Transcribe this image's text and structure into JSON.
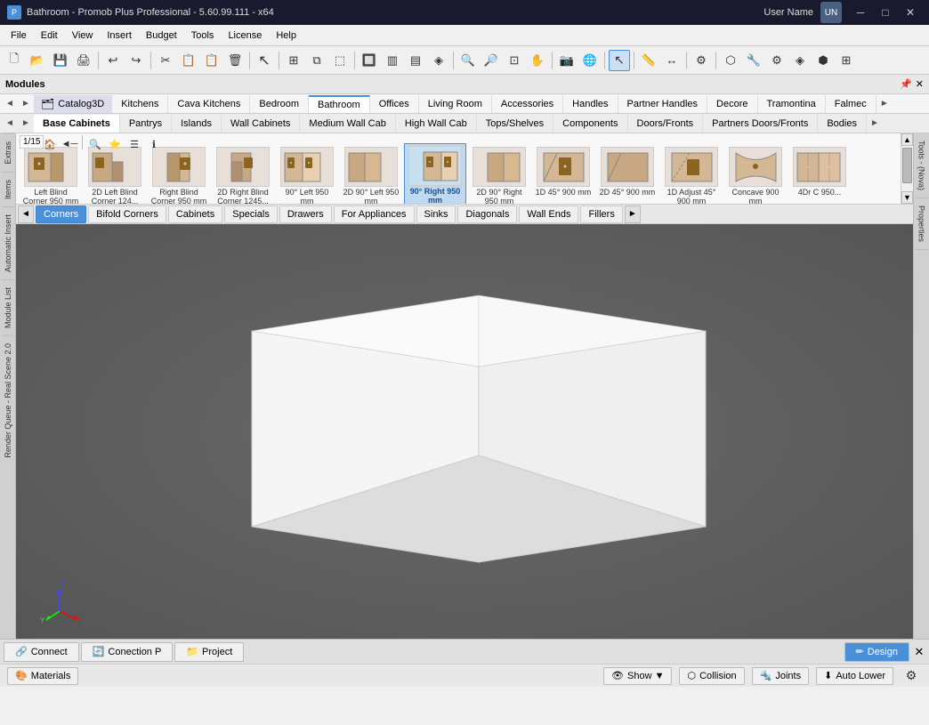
{
  "titlebar": {
    "icon": "P",
    "title": "Bathroom - Promob Plus Professional - 5.60.99.111 - x64",
    "user": "User Name",
    "user_abbr": "UN",
    "min": "─",
    "max": "□",
    "close": "✕"
  },
  "menubar": {
    "items": [
      "File",
      "Edit",
      "View",
      "Insert",
      "Budget",
      "Tools",
      "License",
      "Help"
    ]
  },
  "modules": {
    "title": "Modules",
    "pin_icon": "📌",
    "close_icon": "✕"
  },
  "catalog_tabs1": {
    "nav_left": "◄",
    "nav_right": "►",
    "catalog_label": "Catalog3D",
    "tabs": [
      "Kitchens",
      "Cava Kitchens",
      "Bedroom",
      "Bathroom",
      "Offices",
      "Living Room",
      "Accessories",
      "Handles",
      "Partner Handles",
      "Decore",
      "Tramontina",
      "Falmec",
      "►"
    ]
  },
  "catalog_tabs2": {
    "nav_left": "◄",
    "nav_right": "►",
    "tabs": [
      "Base Cabinets",
      "Pantrys",
      "Islands",
      "Wall Cabinets",
      "Medium Wall Cab",
      "High Wall Cab",
      "Tops/Shelves",
      "Components",
      "Doors/Fronts",
      "Partners Doors/Fronts",
      "Bodies",
      "►"
    ]
  },
  "catalog_items": {
    "page": "1/15",
    "items": [
      {
        "label": "Left Blind Corner 950 mm",
        "shape": "corner_left"
      },
      {
        "label": "2D Left Blind Corner 124...",
        "shape": "corner_2d_left"
      },
      {
        "label": "Right Blind Corner 950 mm",
        "shape": "corner_right"
      },
      {
        "label": "2D Right Blind Corner 1245...",
        "shape": "corner_2d_right"
      },
      {
        "label": "90° Left 950 mm",
        "shape": "corner_90_left"
      },
      {
        "label": "2D 90° Left 950 mm",
        "shape": "corner_90_2d_left"
      },
      {
        "label": "90° Right 950 mm",
        "shape": "corner_90_right"
      },
      {
        "label": "2D 90° Right 950 mm",
        "shape": "corner_90_2d_right"
      },
      {
        "label": "1D 45° 900 mm",
        "shape": "corner_1d_45"
      },
      {
        "label": "2D 45° 900 mm",
        "shape": "corner_2d_45"
      },
      {
        "label": "1D Adjust 45° 900 mm",
        "shape": "corner_adjust"
      },
      {
        "label": "Concave 900 mm",
        "shape": "concave"
      },
      {
        "label": "4Dr C 950...",
        "shape": "four_door"
      }
    ]
  },
  "subcat_tabs": {
    "tabs": [
      "Corners",
      "Bifold Corners",
      "Cabinets",
      "Specials",
      "Drawers",
      "For Appliances",
      "Sinks",
      "Diagonals",
      "Wall Ends",
      "Fillers"
    ],
    "active": "Corners",
    "nav_prev": "◄",
    "nav_next": "►"
  },
  "left_sidebar": {
    "tabs": [
      "Extras",
      "Items",
      "Automatic Insert",
      "Module List",
      "Render Queue - Real Scene 2.0"
    ]
  },
  "right_sidebar": {
    "tabs": [
      "Tools - (Nova)",
      "Properties"
    ]
  },
  "bottom_bar": {
    "tabs": [
      "Connect",
      "Conection P",
      "Project"
    ],
    "active_tab": "Design",
    "close": "✕"
  },
  "statusbar": {
    "materials_label": "Materials",
    "show_label": "Show ▼",
    "collision_label": "Collision",
    "joints_label": "Joints",
    "auto_lower_label": "Auto Lower",
    "settings_icon": "⚙"
  },
  "toolbar": {
    "buttons": [
      "💾",
      "📁",
      "🖨",
      "📋",
      "↩",
      "↪",
      "✂",
      "📋",
      "📋",
      "🔧",
      "▸",
      "⏹",
      "▾",
      "▶",
      "⭕",
      "↗",
      "↙",
      "📐",
      "📐",
      "▣",
      "⊞",
      "🔍",
      "🔍",
      "✋",
      "📷",
      "🌐",
      "📊",
      "📊",
      "🔧",
      "⚙",
      "🔑",
      "🔑",
      "📊",
      "⭕",
      "⬡",
      "🔧",
      "⚙"
    ]
  }
}
